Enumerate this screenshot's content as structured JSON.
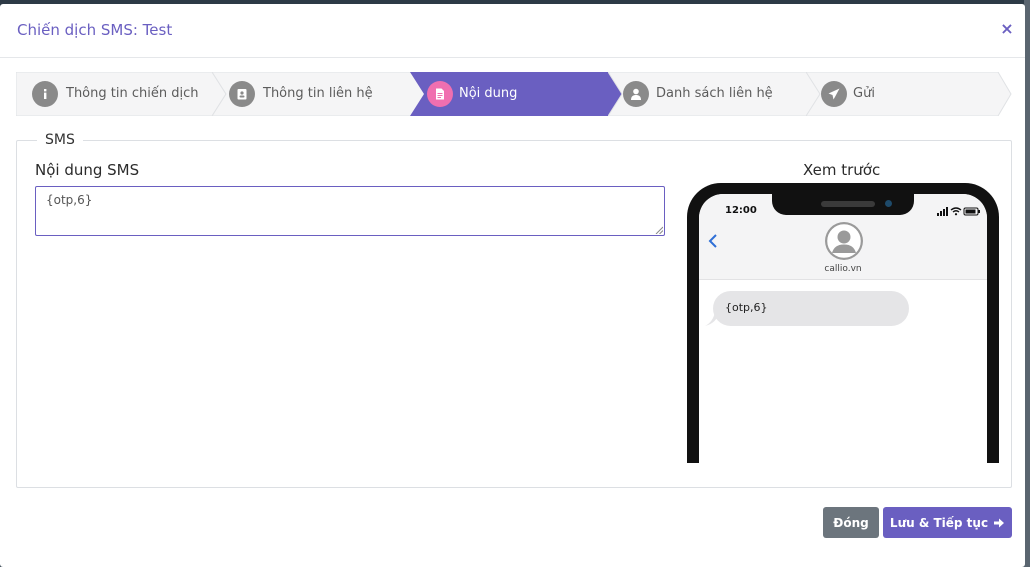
{
  "modal": {
    "title": "Chiến dịch SMS: Test",
    "close_symbol": "×"
  },
  "wizard": {
    "steps": [
      {
        "label": "Thông tin chiến dịch",
        "icon": "info-icon",
        "active": false
      },
      {
        "label": "Thông tin liên hệ",
        "icon": "contact-card-icon",
        "active": false
      },
      {
        "label": "Nội dung",
        "icon": "document-icon",
        "active": true
      },
      {
        "label": "Danh sách liên hệ",
        "icon": "user-icon",
        "active": false
      },
      {
        "label": "Gửi",
        "icon": "paper-plane-icon",
        "active": false
      }
    ]
  },
  "sms_section": {
    "legend": "SMS",
    "content_label": "Nội dung SMS",
    "content_value": "{otp,6}",
    "preview_label": "Xem trước"
  },
  "phone_preview": {
    "time": "12:00",
    "contact_name": "callio.vn",
    "message": "{otp,6}"
  },
  "footer": {
    "close_label": "Đóng",
    "next_label": "Lưu & Tiếp tục"
  },
  "colors": {
    "accent": "#6a5fc1",
    "active_step_icon": "#f06fb0",
    "step_icon": "#8a8a8a",
    "close_button": "#6c757d"
  }
}
